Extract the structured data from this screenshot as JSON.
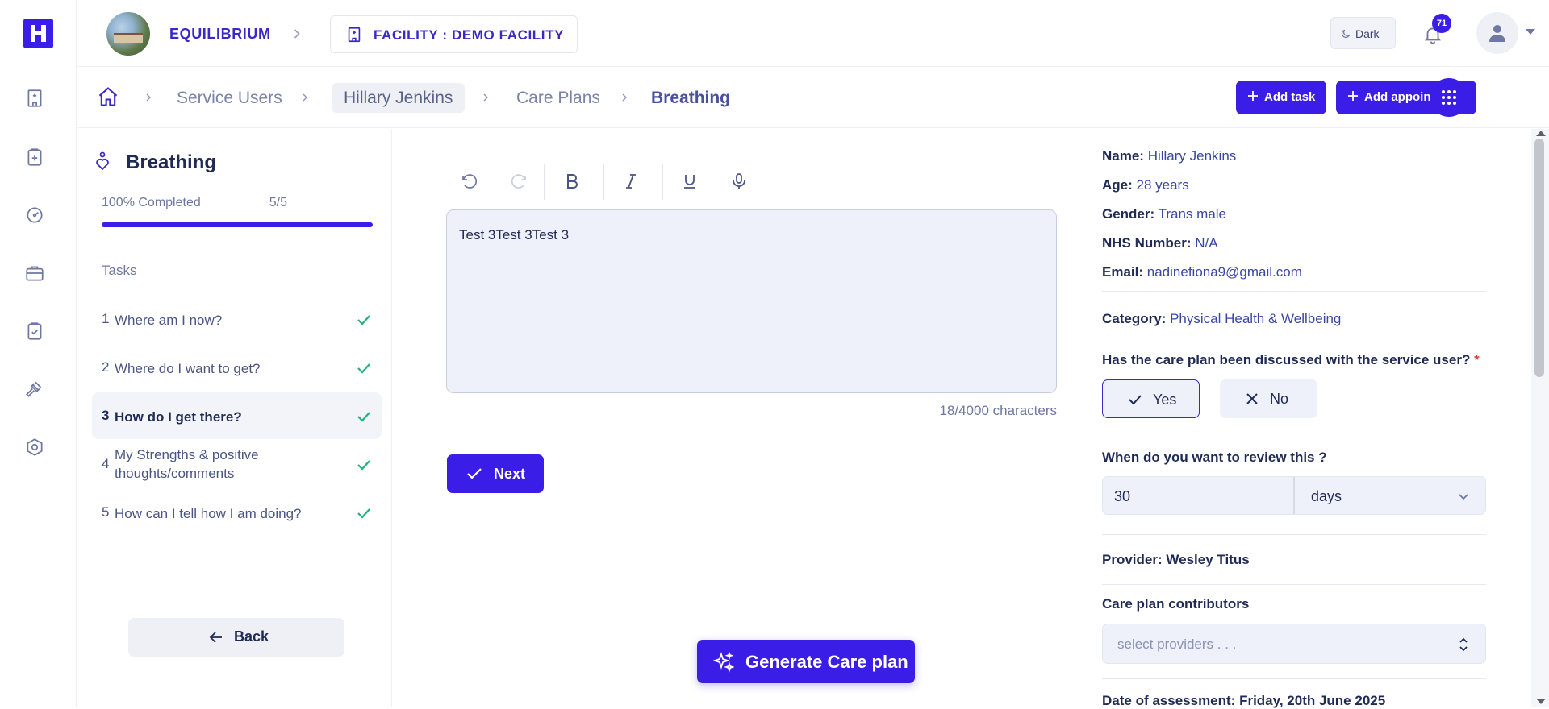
{
  "org": {
    "name": "EQUILIBRIUM"
  },
  "facility": {
    "label": "FACILITY : DEMO FACILITY"
  },
  "header": {
    "dark_label": "Dark",
    "notification_count": "71"
  },
  "breadcrumb": {
    "items": [
      "Service Users",
      "Hillary Jenkins",
      "Care Plans",
      "Breathing"
    ]
  },
  "actions": {
    "add_task": "Add task",
    "add_appointment": "Add appointment"
  },
  "sidebar": {
    "title": "Breathing",
    "progress_label": "100% Completed",
    "progress_count": "5/5",
    "progress_fraction": 1.0,
    "tasks_heading": "Tasks",
    "tasks": [
      {
        "num": "1",
        "label": "Where am I now?"
      },
      {
        "num": "2",
        "label": "Where do I want to get?"
      },
      {
        "num": "3",
        "label": "How do I get there?"
      },
      {
        "num": "4",
        "label": "My Strengths & positive thoughts/comments"
      },
      {
        "num": "5",
        "label": "How can I tell how I am doing?"
      }
    ],
    "back_label": "Back"
  },
  "editor": {
    "content": "Test 3Test 3Test 3",
    "char_count": "18/4000 characters",
    "next_label": "Next",
    "generate_label": "Generate Care plan"
  },
  "details": {
    "name_label": "Name:",
    "name": "Hillary Jenkins",
    "age_label": "Age:",
    "age": "28 years",
    "gender_label": "Gender:",
    "gender": "Trans male",
    "nhs_label": "NHS Number:",
    "nhs": "N/A",
    "email_label": "Email:",
    "email": "nadinefiona9@gmail.com",
    "category_label": "Category:",
    "category": "Physical Health & Wellbeing",
    "discussed_question": "Has the care plan been discussed with the service user?",
    "required_mark": "*",
    "yes_label": "Yes",
    "no_label": "No",
    "review_question": "When do you want to review this ?",
    "review_value": "30",
    "review_unit": "days",
    "provider_label": "Provider:",
    "provider": "Wesley Titus",
    "contributors_label": "Care plan contributors",
    "contributors_placeholder": "select providers . . .",
    "assessment_label": "Date of assessment:",
    "assessment_date": "Friday, 20th June 2025"
  }
}
